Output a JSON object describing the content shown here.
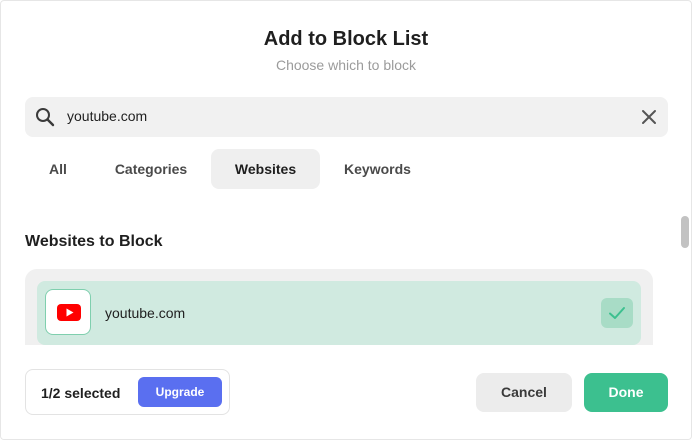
{
  "header": {
    "title": "Add to Block List",
    "subtitle": "Choose which to block"
  },
  "search": {
    "value": "youtube.com",
    "search_icon": "search-icon",
    "clear_icon": "close-icon"
  },
  "tabs": [
    {
      "label": "All",
      "active": false
    },
    {
      "label": "Categories",
      "active": false
    },
    {
      "label": "Websites",
      "active": true
    },
    {
      "label": "Keywords",
      "active": false
    }
  ],
  "section": {
    "title": "Websites to Block"
  },
  "sites": [
    {
      "name": "youtube.com",
      "icon": "youtube-logo-icon",
      "selected": true
    }
  ],
  "footer": {
    "selected_text": "1/2 selected",
    "upgrade_label": "Upgrade",
    "cancel_label": "Cancel",
    "done_label": "Done"
  },
  "colors": {
    "accent_green": "#3cc08f",
    "upgrade_blue": "#5a6ff0",
    "selected_row": "#d0eae0",
    "youtube_red": "#ff0000"
  }
}
